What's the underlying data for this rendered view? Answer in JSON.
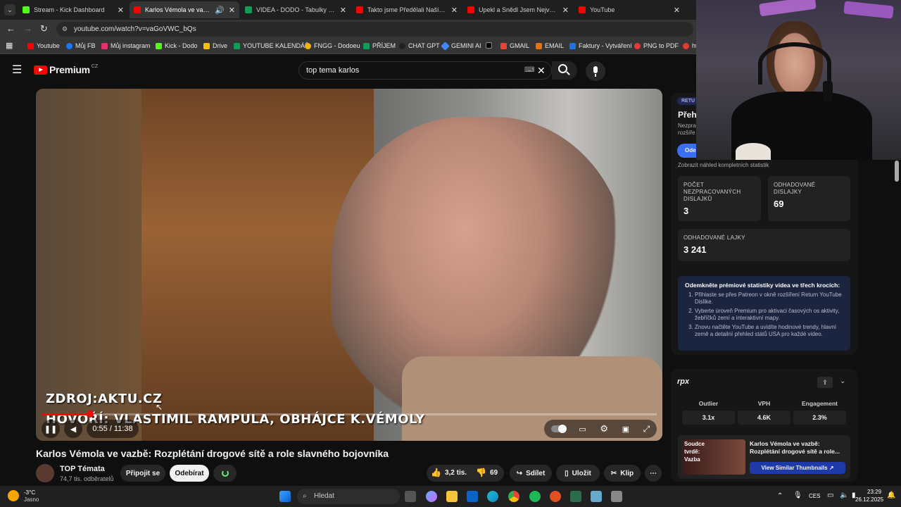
{
  "browser": {
    "tabs": [
      {
        "label": "Stream - Kick Dashboard",
        "color": "#53fc18"
      },
      {
        "label": "Karlos Vémola ve vazbě: Ro",
        "color": "#ff0000"
      },
      {
        "label": "VIDEA - DODO - Tabulky Goog",
        "color": "#0f9d58"
      },
      {
        "label": "Takto jsme Předělali Naší Zahra",
        "color": "#ff0000"
      },
      {
        "label": "Upekl a Snědl Jsem Největší Pá",
        "color": "#ff0000"
      },
      {
        "label": "YouTube",
        "color": "#ff0000"
      }
    ],
    "url": "youtube.com/watch?v=vaGoVWC_bQs",
    "bookmarks": [
      {
        "label": "Youtube",
        "color": "#ff0000"
      },
      {
        "label": "Můj FB",
        "color": "#1877f2"
      },
      {
        "label": "Můj instagram",
        "color": "#e1306c"
      },
      {
        "label": "Kick - Dodo",
        "color": "#53fc18"
      },
      {
        "label": "Drive",
        "color": "#fbbc04"
      },
      {
        "label": "YOUTUBE KALENDÁŘ",
        "color": "#0f9d58"
      },
      {
        "label": "FNGG - Dodoeu",
        "color": "#f4b400"
      },
      {
        "label": "PŘÍJEM",
        "color": "#0f9d58"
      },
      {
        "label": "CHAT GPT",
        "color": "#222222"
      },
      {
        "label": "GEMINI AI",
        "color": "#4285f4"
      },
      {
        "label": "",
        "color": "#000000"
      },
      {
        "label": "GMAIL",
        "color": "#ea4335"
      },
      {
        "label": "EMAIL",
        "color": "#e8710a"
      },
      {
        "label": "Faktury - Vytváření",
        "color": "#1a73e8"
      },
      {
        "label": "PNG to PDF",
        "color": "#e53935"
      },
      {
        "label": "ht",
        "color": "#e53935"
      }
    ]
  },
  "youtube": {
    "logo_text": "Premium",
    "logo_region": "CZ",
    "search_query": "top tema karlos"
  },
  "video": {
    "overlay_source": "ZDROJ:AKTU.CZ",
    "overlay_speaker": "HOVOŘÍ: VLASTIMIL RAMPULA, OBHÁJCE K.VÉMOLY",
    "time": "0:55 / 11:38",
    "progress": 0.079,
    "title": "Karlos Vémola ve vazbě: Rozplétání drogové sítě a role slavného bojovníka",
    "channel": "TOP Témata",
    "subscribers": "74,7 tis. odběratelů",
    "join_label": "Připojit se",
    "subscribe_label": "Odebírat",
    "likes": "3,2 tis.",
    "dislikes": "69",
    "share_label": "Sdílet",
    "save_label": "Uložit",
    "clip_label": "Klip"
  },
  "extension": {
    "badge": "RETU",
    "heading": "Přeh",
    "desc_line1": "Nezpra",
    "desc_line2": "rozšíře",
    "button_label": "Ode",
    "full_stats_link": "Zobrazit náhled kompletních statistik",
    "stats": [
      {
        "label": "POČET NEZPRACOVANÝCH DISLAJKŮ",
        "value": "3"
      },
      {
        "label": "ODHADOVANÉ DISLAJKY",
        "value": "69"
      },
      {
        "label": "ODHADOVANÉ LAJKY",
        "value": "3 241"
      }
    ],
    "promo_title": "Odemkněte prémiové statistiky videa ve třech krocích:",
    "promo_steps": [
      "Přihlaste se přes Patreon v okně rozšíření Return YouTube Dislike.",
      "Vyberte úroveň Premium pro aktivaci časových os aktivity, žebříčků zemí a interaktivní mapy.",
      "Znovu načtěte YouTube a uvidíte hodinové trendy, hlavní země a detailní přehled států USA pro každé video."
    ]
  },
  "metrics_panel": {
    "logo": "rpx",
    "metrics": [
      {
        "label": "Outlier",
        "value": "3.1x"
      },
      {
        "label": "VPH",
        "value": "4.6K"
      },
      {
        "label": "Engagement",
        "value": "2.3%"
      }
    ],
    "thumb_text1": "Soudce",
    "thumb_text2": "tvrdě:",
    "thumb_text3": "Vazba",
    "thumb_title": "Karlos Vémola ve vazbě: Rozplétání drogové sítě a role...",
    "similar_label": "View Similar Thumbnails"
  },
  "taskbar": {
    "weather_temp": "-3°C",
    "weather_desc": "Jasno",
    "search_placeholder": "Hledat",
    "lang": "CES",
    "time": "23:29",
    "date": "26.12.2025"
  }
}
